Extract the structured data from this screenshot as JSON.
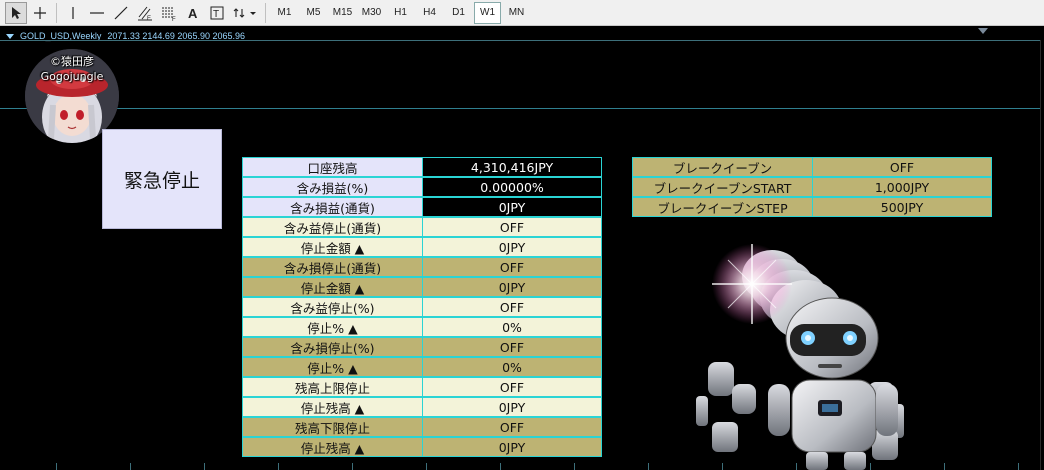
{
  "toolbar": {
    "tools": [
      {
        "name": "cursor-tool",
        "glyph": "↖"
      },
      {
        "name": "crosshair-tool",
        "glyph": "+"
      },
      {
        "name": "vertical-line-tool",
        "glyph": "|"
      },
      {
        "name": "horizontal-line-tool",
        "glyph": "—"
      },
      {
        "name": "trendline-tool",
        "glyph": "/"
      },
      {
        "name": "equidistant-channel-tool",
        "glyph": "▨"
      },
      {
        "name": "fibonacci-tool",
        "glyph": "☰"
      },
      {
        "name": "text-tool",
        "glyph": "A"
      },
      {
        "name": "text-label-tool",
        "glyph": "T"
      },
      {
        "name": "arrows-tool",
        "glyph": "⇵▾"
      }
    ],
    "timeframes": [
      "M1",
      "M5",
      "M15",
      "M30",
      "H1",
      "H4",
      "D1",
      "W1",
      "MN"
    ],
    "active_timeframe": "W1"
  },
  "chart": {
    "symbol": "GOLD_USD,Weekly",
    "ohlc": "2071.33 2144.69 2065.90 2065.96"
  },
  "avatar": {
    "line1": "©猿田彦",
    "line2": "Gogojungle"
  },
  "emergency_stop": {
    "label": "緊急停止"
  },
  "settings": {
    "rows": [
      {
        "label": "口座残高",
        "value": "4,310,416JPY"
      },
      {
        "label": "含み損益(%)",
        "value": "0.00000%"
      },
      {
        "label": "含み損益(通貨)",
        "value": "0JPY"
      },
      {
        "label": "含み益停止(通貨)",
        "value": "OFF"
      },
      {
        "label": "停止金額 ▲",
        "value": "0JPY"
      },
      {
        "label": "含み損停止(通貨)",
        "value": "OFF"
      },
      {
        "label": "停止金額 ▲",
        "value": "0JPY"
      },
      {
        "label": "含み益停止(%)",
        "value": "OFF"
      },
      {
        "label": "停止% ▲",
        "value": "0%"
      },
      {
        "label": "含み損停止(%)",
        "value": "OFF"
      },
      {
        "label": "停止% ▲",
        "value": "0%"
      },
      {
        "label": "残高上限停止",
        "value": "OFF"
      },
      {
        "label": "停止残高 ▲",
        "value": "0JPY"
      },
      {
        "label": "残高下限停止",
        "value": "OFF"
      },
      {
        "label": "停止残高 ▲",
        "value": "0JPY"
      }
    ]
  },
  "breakeven": {
    "rows": [
      {
        "label": "ブレークイーブン",
        "value": "OFF"
      },
      {
        "label": "ブレークイーブンSTART",
        "value": "1,000JPY"
      },
      {
        "label": "ブレークイーブンSTEP",
        "value": "500JPY"
      }
    ]
  },
  "colors": {
    "table_border": "#2ad4d4",
    "lavender": "#e4e4fa",
    "cream": "#f3f3d9",
    "khaki": "#bdb373",
    "chart_bg": "#000000"
  }
}
